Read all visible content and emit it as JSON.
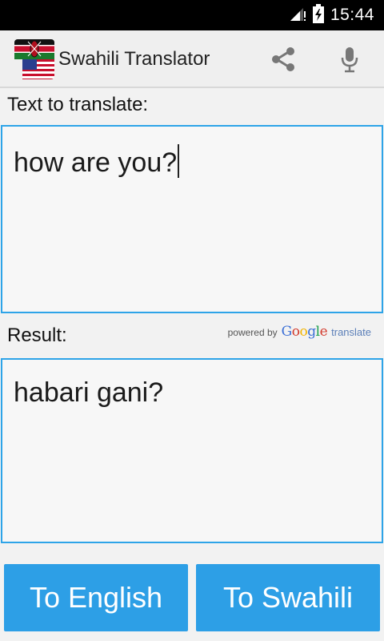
{
  "status_bar": {
    "time": "15:44"
  },
  "action_bar": {
    "title": "Swahili Translator",
    "icons": [
      "kenya-flag-icon",
      "us-flag-icon",
      "share-icon",
      "microphone-icon"
    ]
  },
  "input_section": {
    "label": "Text to translate:",
    "value": "how are you?"
  },
  "result_section": {
    "label": "Result:",
    "value": "habari gani?",
    "powered_by": "powered by",
    "google": "Google",
    "translate": "translate"
  },
  "buttons": {
    "to_english": "To English",
    "to_swahili": "To Swahili"
  },
  "colors": {
    "accent": "#2d9fe6",
    "box_border": "#2ea4e8"
  }
}
